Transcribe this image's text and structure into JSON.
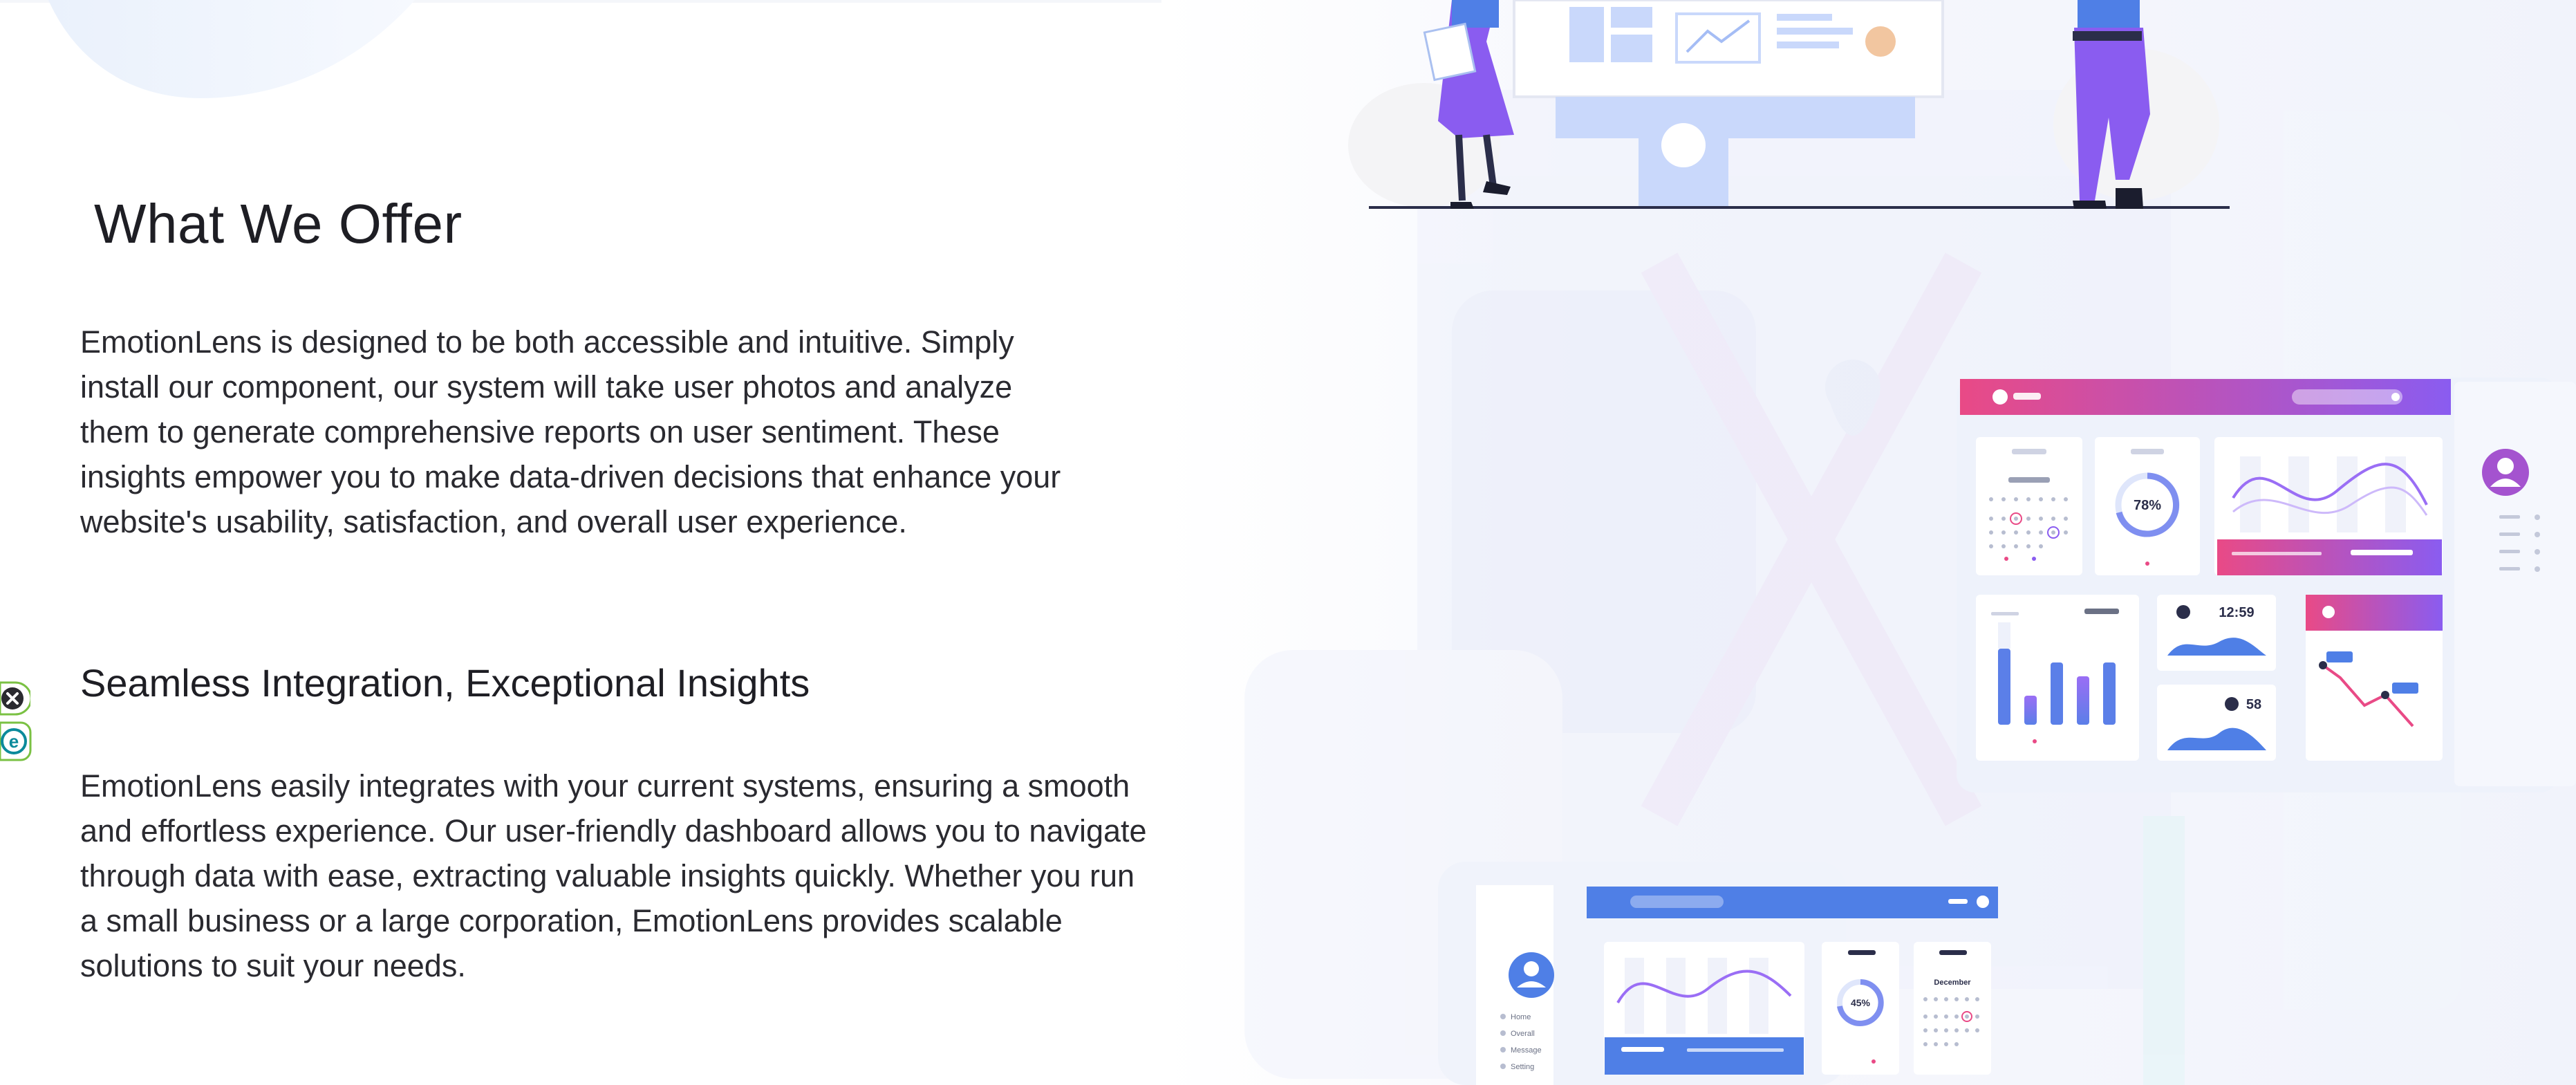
{
  "page": {
    "heading": "What We Offer",
    "intro": "EmotionLens is designed to be both accessible and intuitive. Simply install our component, our system will take user photos and analyze them to generate comprehensive reports on user sentiment. These insights empower you to make data-driven decisions that enhance your website's usability, satisfaction, and overall user experience.",
    "subheading": "Seamless Integration, Exceptional Insights",
    "body": "EmotionLens easily integrates with your current systems, ensuring a smooth and effortless experience. Our user-friendly dashboard allows you to navigate through data with ease, extracting valuable insights quickly. Whether you run a small business or a large corporation, EmotionLens provides scalable solutions to suit your needs."
  },
  "extension_widget": {
    "close_icon": "close-circle-icon",
    "logo_letter": "e",
    "logo_icon": "eset-logo-icon"
  },
  "illustration": {
    "theme_colors": {
      "pink": "#e94a86",
      "purple": "#8a5cf0",
      "blue": "#4f7fe6",
      "light_blue": "#c9d8fb",
      "pale": "#f2f5fc"
    },
    "dashboard_main": {
      "kpi": "78%",
      "clock": "12:59",
      "kpi_small": "58"
    },
    "dashboard_bottom": {
      "donut_value": "45%",
      "calendar_month": "December",
      "sidebar_items": [
        "Home",
        "Overall",
        "Message",
        "Setting"
      ]
    }
  }
}
